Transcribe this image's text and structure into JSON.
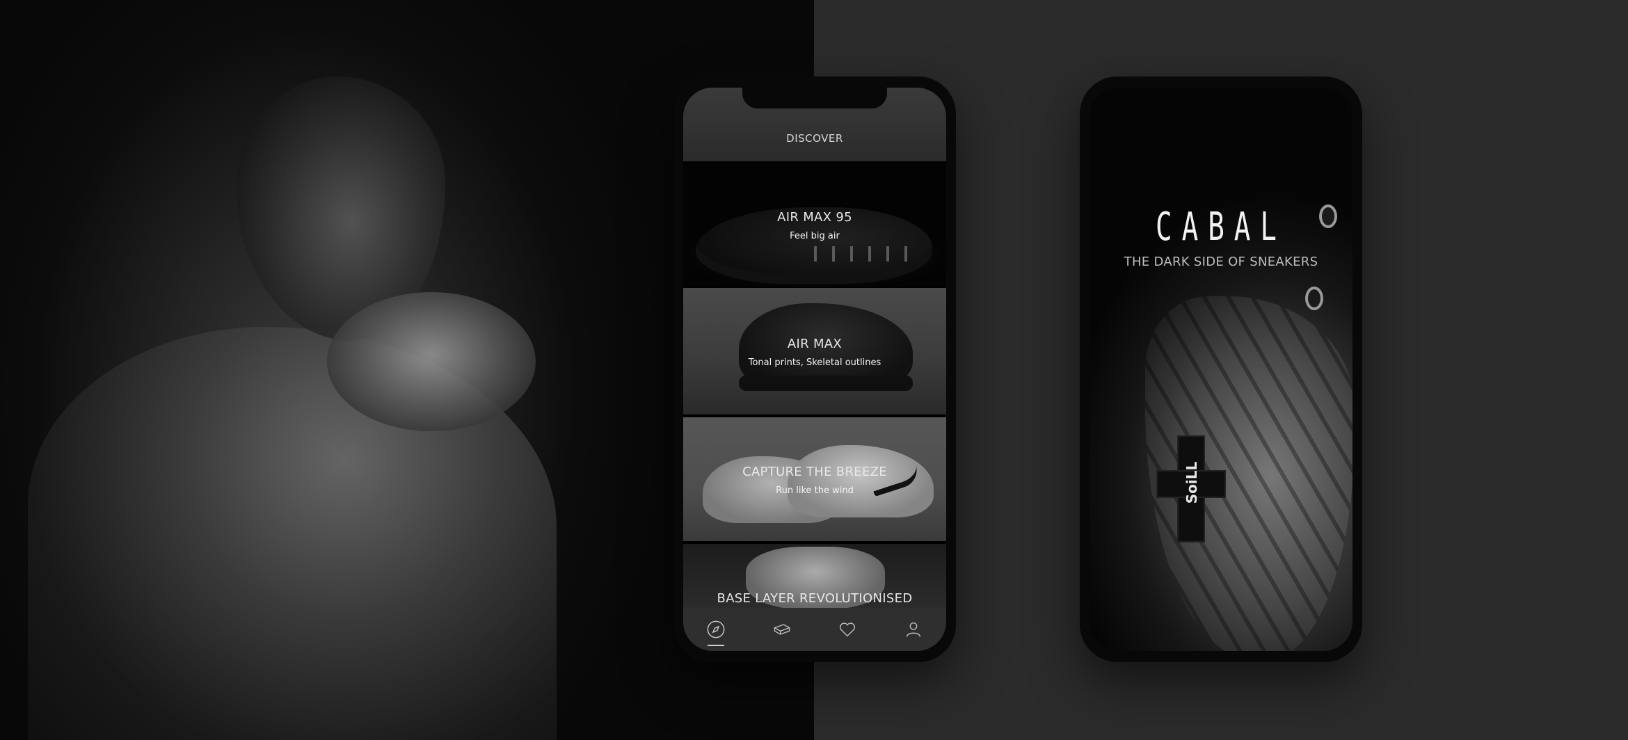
{
  "discover": {
    "header_title": "DISCOVER",
    "cards": [
      {
        "title": "AIR MAX 95",
        "subtitle": "Feel big air"
      },
      {
        "title": "AIR MAX",
        "subtitle": "Tonal prints, Skeletal outlines"
      },
      {
        "title": "CAPTURE THE BREEZE",
        "subtitle": "Run like the wind"
      },
      {
        "title": "BASE LAYER REVOLUTIONISED",
        "subtitle": ""
      }
    ],
    "tabbar": [
      {
        "icon": "compass-icon",
        "active": true
      },
      {
        "icon": "box-icon",
        "active": false
      },
      {
        "icon": "heart-icon",
        "active": false
      },
      {
        "icon": "user-icon",
        "active": false
      }
    ]
  },
  "cabal": {
    "logo": "CABAL",
    "tagline": "THE DARK SIDE OF SNEAKERS",
    "patch_text": "SoiLL"
  }
}
